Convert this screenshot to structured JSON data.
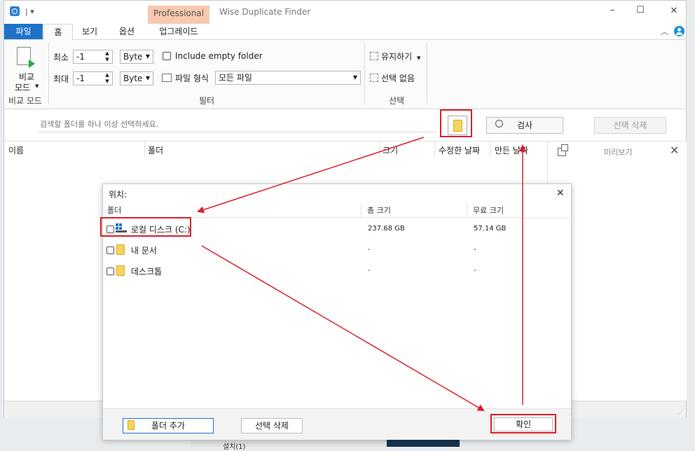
{
  "window": {
    "title": "Wise Duplicate Finder",
    "edition_badge": "Professional",
    "minimize": "–",
    "maximize": "☐",
    "close": "✕",
    "quick_access": "|  ▾"
  },
  "ribbon_tabs": [
    {
      "label": "파일"
    },
    {
      "label": "홈"
    },
    {
      "label": "보기"
    },
    {
      "label": "옵션"
    },
    {
      "label": "업그레이드"
    }
  ],
  "ribbon": {
    "compare_mode": {
      "label_line1": "비교",
      "label_line2": "모드",
      "group": "비교 모드"
    },
    "min_label": "최소",
    "min_value": "-1",
    "min_unit": "Byte",
    "max_label": "최대",
    "max_value": "-1",
    "max_unit": "Byte",
    "include_empty": "Include empty folder",
    "file_type_label": "파일 형식",
    "file_type_value": "모든 파일",
    "filter_group": "필터",
    "keep_label": "유지하기",
    "deselect_label": "선택 없음",
    "select_group": "선택"
  },
  "search_bar": {
    "placeholder": "검색할 폴더를 하나 이상 선택하세요.",
    "scan_button": "검사",
    "delete_button": "선택 삭제"
  },
  "results_columns": [
    "이름",
    "폴더",
    "크기",
    "수정한 날짜",
    "만든 날짜"
  ],
  "preview": {
    "label": "미리보기"
  },
  "dialog": {
    "title": "위치:",
    "columns": [
      "폴더",
      "총 크기",
      "무료 크기"
    ],
    "rows": [
      {
        "name": "로컬 디스크 (C:)",
        "total": "237.68 GB",
        "free": "57.14 GB",
        "icon": "drive-icon"
      },
      {
        "name": "내 문서",
        "total": "-",
        "free": "-",
        "icon": "folder-icon"
      },
      {
        "name": "데스크톱",
        "total": "-",
        "free": "-",
        "icon": "folder-icon"
      }
    ],
    "add_folder": "폴더 추가",
    "delete_selected": "선택 삭제",
    "ok": "확인"
  },
  "background_text": "설치(1)",
  "colors": {
    "accent": "#1e73c8",
    "annotation_red": "#d9202a",
    "badge_bg": "#f8c8b0",
    "folder_yellow": "#f6d35e"
  }
}
